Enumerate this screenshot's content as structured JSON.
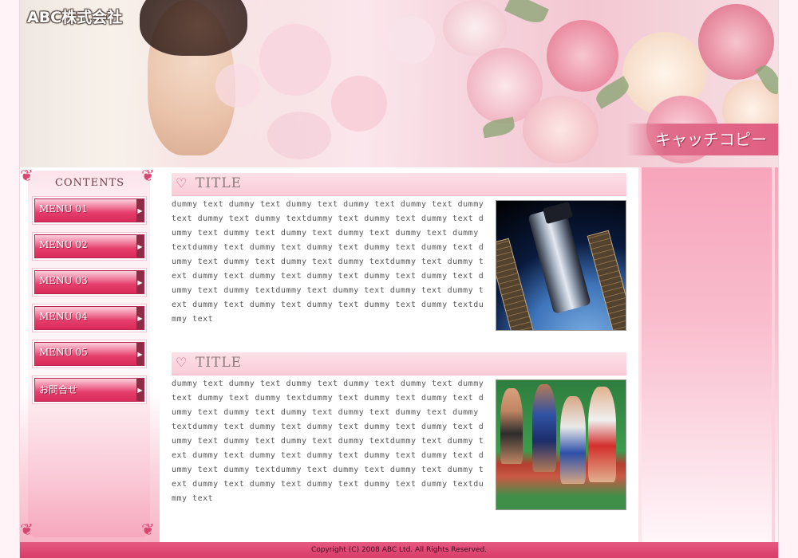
{
  "header": {
    "company": "ABC株式会社",
    "catch_copy": "キャッチコピー"
  },
  "sidebar": {
    "title": "CONTENTS",
    "items": [
      {
        "label": "MENU 01"
      },
      {
        "label": "MENU 02"
      },
      {
        "label": "MENU 03"
      },
      {
        "label": "MENU 04"
      },
      {
        "label": "MENU 05"
      },
      {
        "label": "お問合せ"
      }
    ]
  },
  "sections": [
    {
      "title": "TITLE",
      "body": "dummy text dummy text dummy text dummy text dummy text dummy text dummy text dummy textdummy text dummy text dummy text dummy text dummy text dummy text dummy text dummy text dummy textdummy text dummy text dummy text dummy text dummy text dummy text dummy text dummy text dummy textdummy text dummy text dummy text dummy text dummy text dummy text dummy text dummy text dummy textdummy text dummy text dummy text dummy text dummy text dummy text dummy text dummy text dummy textdummy text",
      "photo": "space-telescope"
    },
    {
      "title": "TITLE",
      "body": "dummy text dummy text dummy text dummy text dummy text dummy text dummy text dummy textdummy text dummy text dummy text dummy text dummy text dummy text dummy text dummy text dummy textdummy text dummy text dummy text dummy text dummy text dummy text dummy text dummy text dummy textdummy text dummy text dummy text dummy text dummy text dummy text dummy text dummy text dummy textdummy text dummy text dummy text dummy text dummy text dummy text dummy text dummy text dummy textdummy text",
      "photo": "runners"
    }
  ],
  "footer": {
    "copyright": "Copyright (C) 2008 ABC Ltd. All Rights Reserved."
  },
  "colors": {
    "accent": "#e05f82",
    "menu_gradient_dark": "#d92b5b",
    "footer": "#d83b68"
  },
  "icons": {
    "section_icon": "ribbon-heart-icon",
    "menu_arrow": "arrow-right-icon",
    "ornament": "floral-ornament-icon"
  }
}
